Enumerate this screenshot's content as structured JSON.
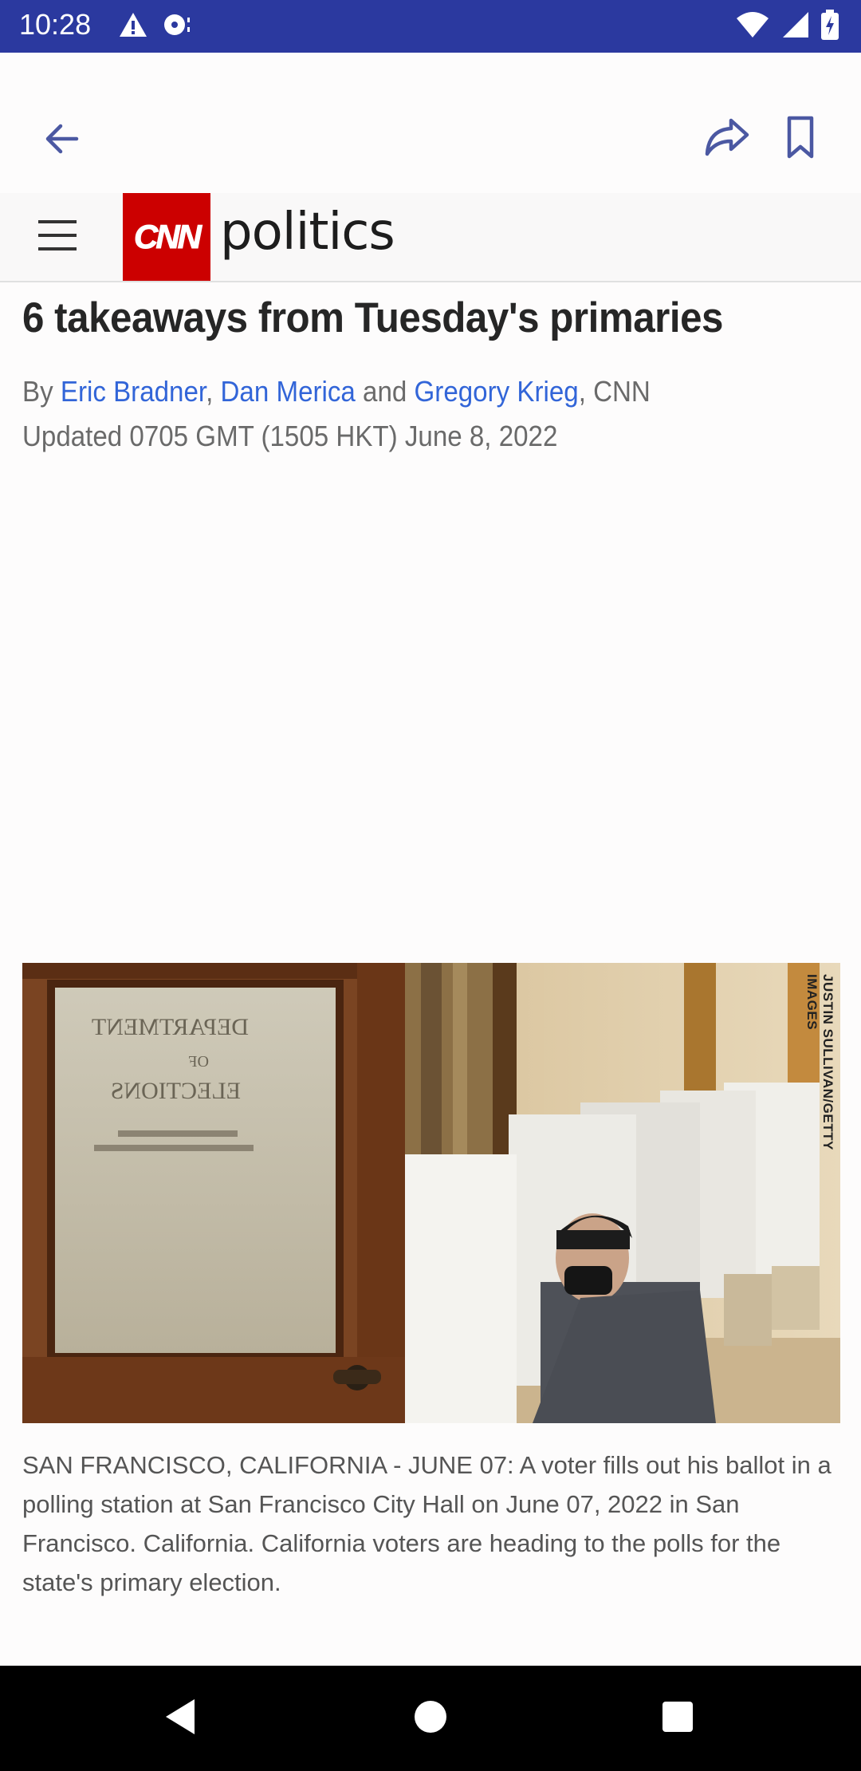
{
  "status_bar": {
    "time": "10:28",
    "left_icons": [
      "warning-icon",
      "record-icon"
    ],
    "right_icons": [
      "wifi-icon",
      "signal-icon",
      "battery-charging-icon"
    ],
    "bg_color": "#2b399f"
  },
  "app_bar": {
    "icons": [
      "back-arrow-icon",
      "share-icon",
      "bookmark-icon"
    ]
  },
  "site_header": {
    "logo_text": "CNN",
    "section": "politics",
    "logo_color": "#cc0000"
  },
  "article": {
    "headline": "6 takeaways from Tuesday's primaries",
    "byline": {
      "prefix": "By ",
      "author1": "Eric Bradner",
      "sep1": ", ",
      "author2": "Dan Merica",
      "sep2": " and ",
      "author3": "Gregory Krieg",
      "suffix": ", CNN"
    },
    "updated": "Updated 0705 GMT (1505 HKT) June 8, 2022",
    "link_color": "#3265d8",
    "image": {
      "credit": "JUSTIN SULLIVAN/GETTY IMAGES",
      "door_text": [
        "DEPARTMENT",
        "OF",
        "ELECTIONS"
      ],
      "caption": "SAN FRANCISCO, CALIFORNIA - JUNE 07: A voter fills out his ballot in a polling station at San Francisco City Hall on June 07, 2022 in San Francisco. California. California voters are heading to the polls for the state's primary election."
    }
  },
  "nav_bar": {
    "icons": [
      "nav-back-icon",
      "nav-home-icon",
      "nav-recents-icon"
    ]
  }
}
